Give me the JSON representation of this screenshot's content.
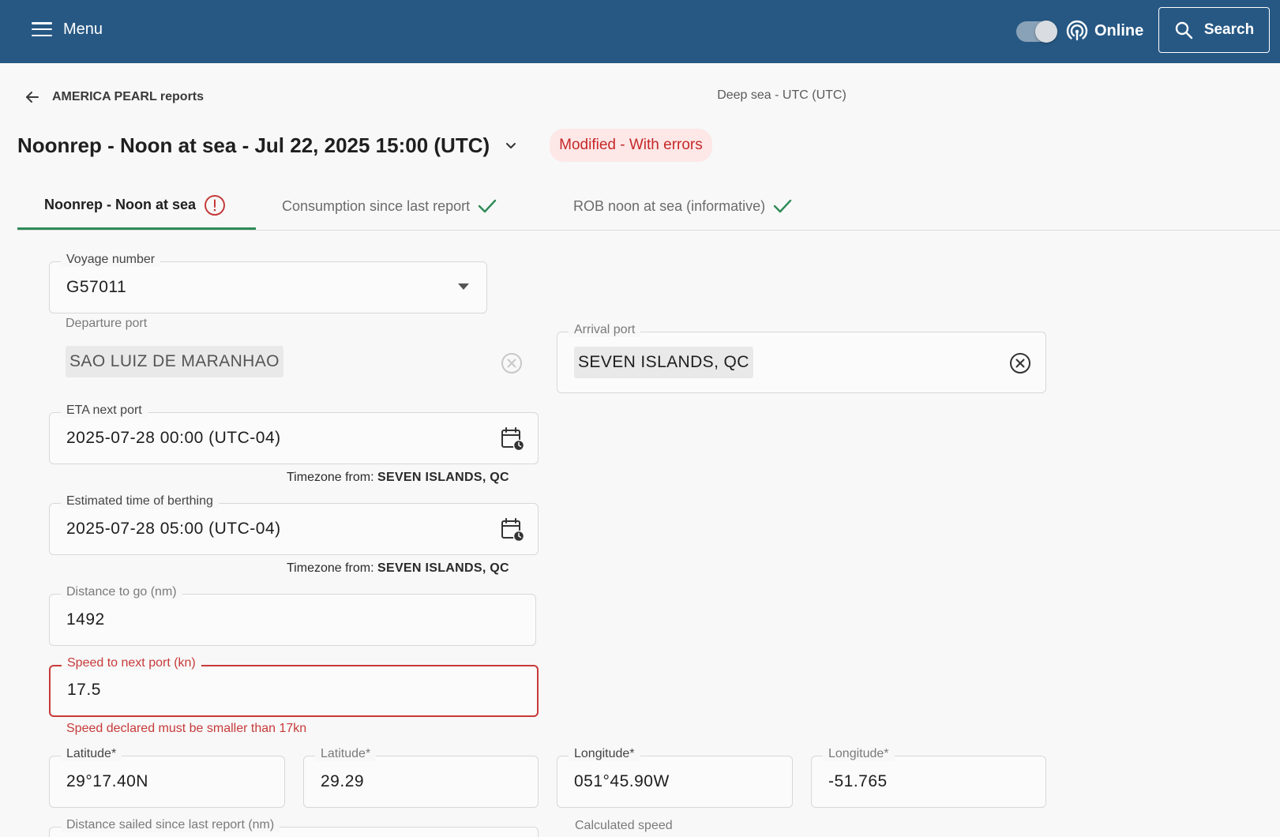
{
  "header": {
    "menu_label": "Menu",
    "status_label": "Online",
    "search_label": "Search",
    "accent_color": "#275884"
  },
  "breadcrumb": {
    "back_label": "AMERICA PEARL reports",
    "timezone_label": "Deep sea - UTC (UTC)"
  },
  "report": {
    "title": "Noonrep - Noon at sea - Jul 22, 2025 15:00 (UTC)",
    "status_badge": "Modified - With errors"
  },
  "tabs": [
    {
      "label": "Noonrep - Noon at sea",
      "status": "error"
    },
    {
      "label": "Consumption since last report",
      "status": "ok"
    },
    {
      "label": "ROB noon at sea (informative)",
      "status": "ok"
    }
  ],
  "form": {
    "voyage": {
      "label": "Voyage number",
      "value": "G57011"
    },
    "departure": {
      "label": "Departure port",
      "value": "SAO LUIZ DE MARANHAO"
    },
    "arrival": {
      "label": "Arrival port",
      "value": "SEVEN ISLANDS, QC"
    },
    "eta": {
      "label": "ETA next port",
      "value": "2025-07-28 00:00 (UTC-04)",
      "tz_prefix": "Timezone from:",
      "tz_port": "SEVEN ISLANDS, QC"
    },
    "etb": {
      "label": "Estimated time of berthing",
      "value": "2025-07-28 05:00 (UTC-04)",
      "tz_prefix": "Timezone from:",
      "tz_port": "SEVEN ISLANDS, QC"
    },
    "distance_to_go": {
      "label": "Distance to go (nm)",
      "value": "1492"
    },
    "speed_next_port": {
      "label": "Speed to next port (kn)",
      "value": "17.5",
      "error": "Speed declared must be smaller than 17kn"
    },
    "latitude_dm": {
      "label": "Latitude*",
      "value": "29°17.40N"
    },
    "latitude_dec": {
      "label": "Latitude*",
      "value": "29.29"
    },
    "longitude_dm": {
      "label": "Longitude*",
      "value": "051°45.90W"
    },
    "longitude_dec": {
      "label": "Longitude*",
      "value": "-51.765"
    },
    "distance_sailed_label": "Distance sailed since last report (nm)",
    "calculated_speed_label": "Calculated speed"
  },
  "colors": {
    "error": "#c73a3a",
    "success": "#2e8b57",
    "badge_bg": "#fde7e7"
  },
  "icons": [
    "hamburger-icon",
    "broadcast-icon",
    "search-icon",
    "arrow-left-icon",
    "chevron-down-icon",
    "error-circle-icon",
    "check-icon",
    "dropdown-arrow-icon",
    "clear-circle-icon",
    "calendar-clock-icon"
  ]
}
